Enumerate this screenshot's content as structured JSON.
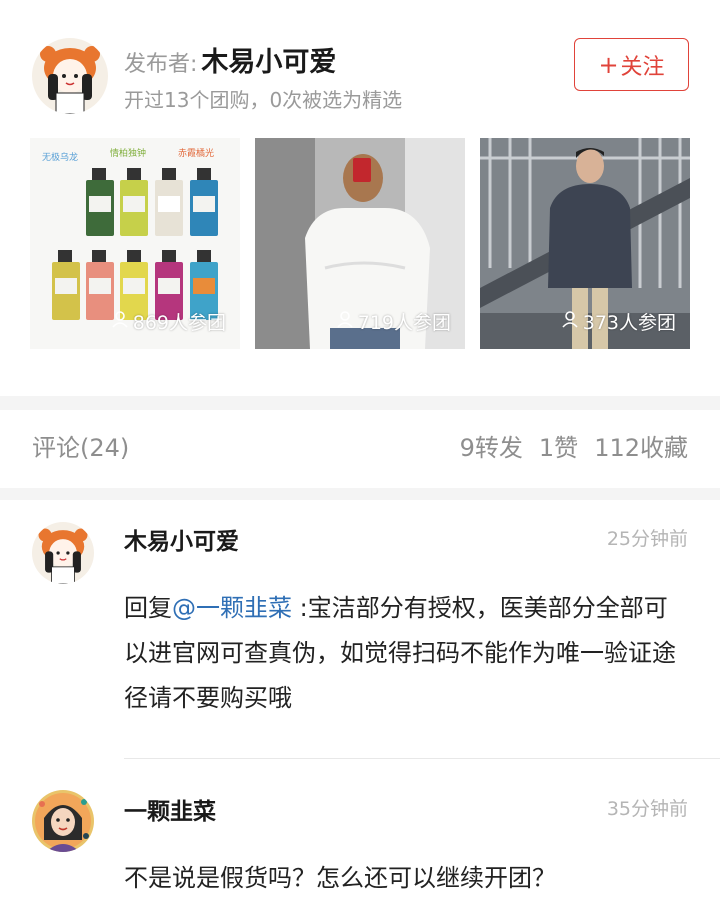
{
  "publisher": {
    "prefix": "发布者:",
    "name": "木易小可爱",
    "stats": "开过13个团购，0次被选为精选",
    "follow_label": "关注",
    "follow_plus": "+"
  },
  "products": [
    {
      "count": "869人参团",
      "image": "perfume-bottles",
      "handwritten_labels": [
        "无极乌龙",
        "情柏独钟",
        "赤霞橘光"
      ]
    },
    {
      "count": "719人参团",
      "image": "woman-mirror-selfie"
    },
    {
      "count": "373人参团",
      "image": "man-jacket-stairs"
    }
  ],
  "stats_bar": {
    "comments": "评论(24)",
    "reposts": "9转发",
    "likes": "1赞",
    "favorites": "112收藏"
  },
  "comments": [
    {
      "name": "木易小可爱",
      "time": "25分钟前",
      "reply_prefix": "回复",
      "mention": "@一颗韭菜",
      "text": " :宝洁部分有授权，医美部分全部可以进官网可查真伪，如觉得扫码不能作为唯一验证途径请不要购买哦"
    },
    {
      "name": "一颗韭菜",
      "time": "35分钟前",
      "text": "不是说是假货吗？怎么还可以继续开团？"
    }
  ],
  "colors": {
    "accent": "#e0433a",
    "mention": "#2f6fb5",
    "muted": "#9a9a9a"
  }
}
